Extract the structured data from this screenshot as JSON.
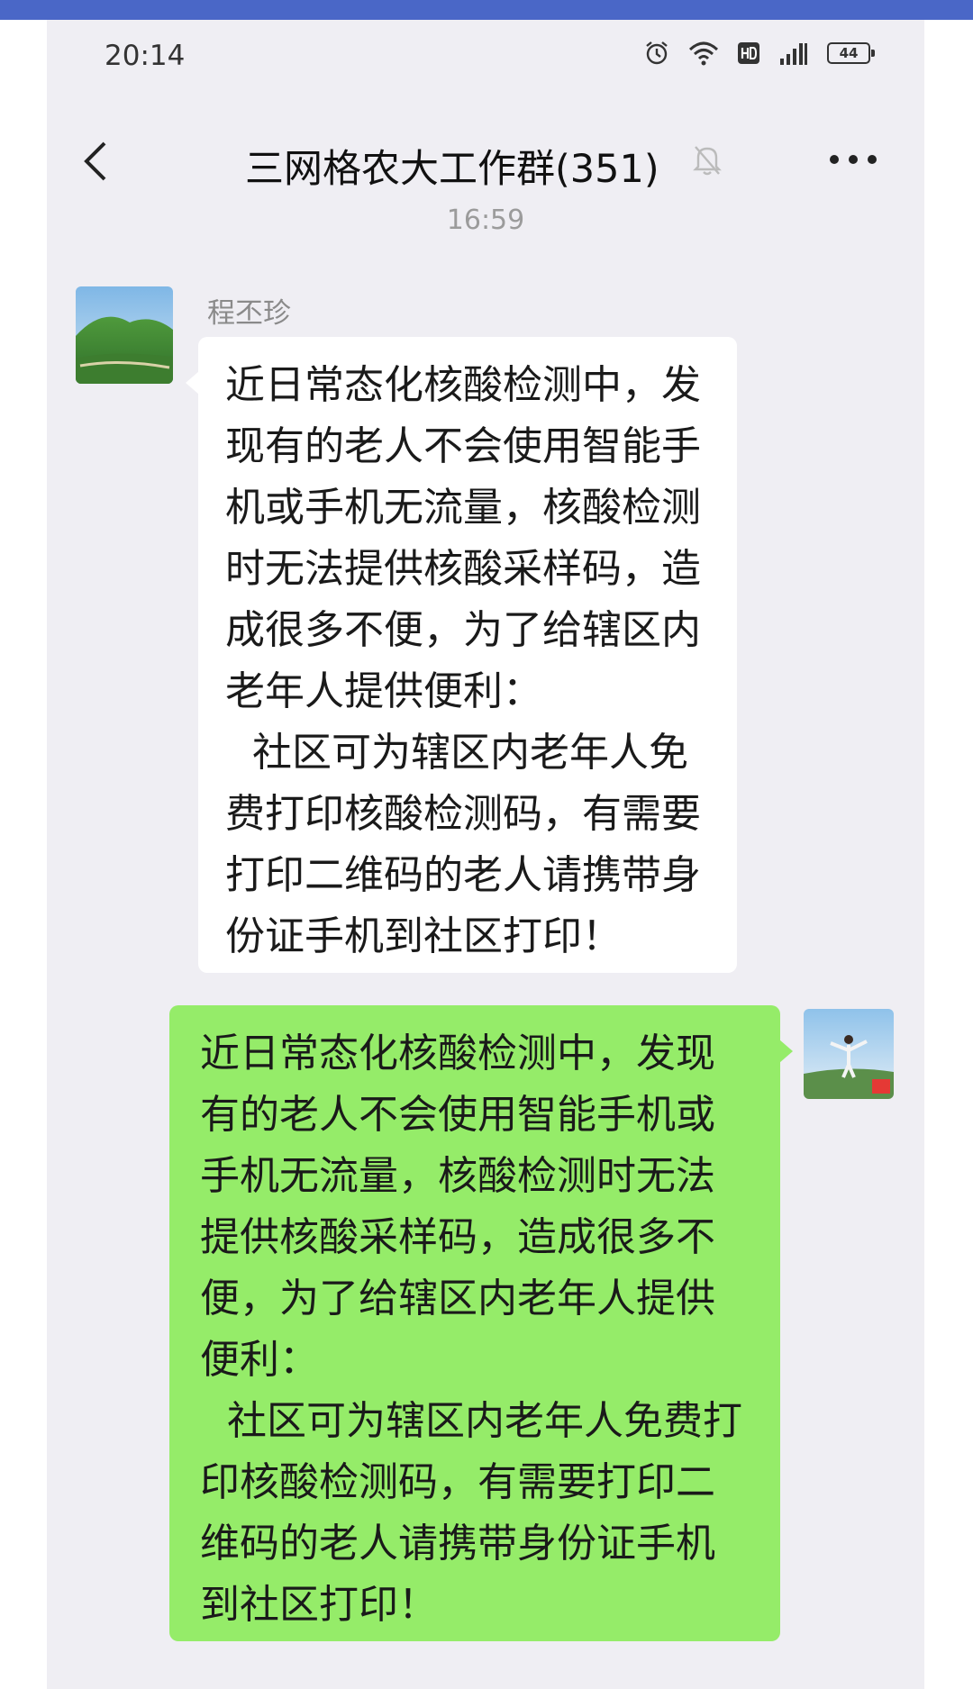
{
  "status_bar": {
    "time": "20:14",
    "icons": [
      "alarm-icon",
      "wifi-icon",
      "hd-icon",
      "signal-icon",
      "battery-icon"
    ],
    "battery_text": "44"
  },
  "header": {
    "title": "三网格农大工作群(351)",
    "back_icon": "chevron-left-icon",
    "mute_icon": "bell-muted-icon",
    "more_icon": "more-dots-icon"
  },
  "timestamp": "16:59",
  "messages": [
    {
      "side": "left",
      "sender": "程丕珍",
      "paragraph_1": "近日常态化核酸检测中，发现有的老人不会使用智能手机或手机无流量，核酸检测时无法提供核酸采样码，造成很多不便，为了给辖区内老年人提供便利：",
      "paragraph_2": "社区可为辖区内老年人免费打印核酸检测码，有需要打印二维码的老人请携带身份证手机到社区打印！"
    },
    {
      "side": "right",
      "paragraph_1": "近日常态化核酸检测中，发现有的老人不会使用智能手机或手机无流量，核酸检测时无法提供核酸采样码，造成很多不便，为了给辖区内老年人提供便利：",
      "paragraph_2": "社区可为辖区内老年人免费打印核酸检测码，有需要打印二维码的老人请携带身份证手机到社区打印！"
    }
  ],
  "colors": {
    "top_bar": "#4a67c7",
    "chat_background": "#efeef3",
    "incoming_bubble": "#ffffff",
    "outgoing_bubble": "#95ec69"
  }
}
